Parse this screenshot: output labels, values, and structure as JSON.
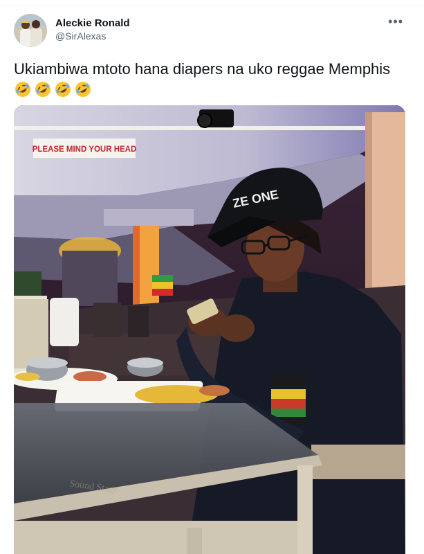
{
  "tweet": {
    "author": {
      "display_name": "Aleckie Ronald",
      "handle": "@SirAlexas",
      "avatar_icon": "profile-photo"
    },
    "more_icon": "more-options-icon",
    "text": "Ukiambiwa mtoto hana diapers na uko reggae Memphis",
    "emojis": [
      "rolling-on-floor-laughing",
      "rolling-on-floor-laughing",
      "rolling-on-floor-laughing",
      "rolling-on-floor-laughing"
    ],
    "media": {
      "sign_text": "PLEASE MIND YOUR HEAD",
      "cap_logo": "ZE ONE",
      "table_watermark": "Sound Stage"
    }
  },
  "colors": {
    "text_primary": "#0f1419",
    "text_secondary": "#536471",
    "emoji_face": "#f7c531"
  }
}
